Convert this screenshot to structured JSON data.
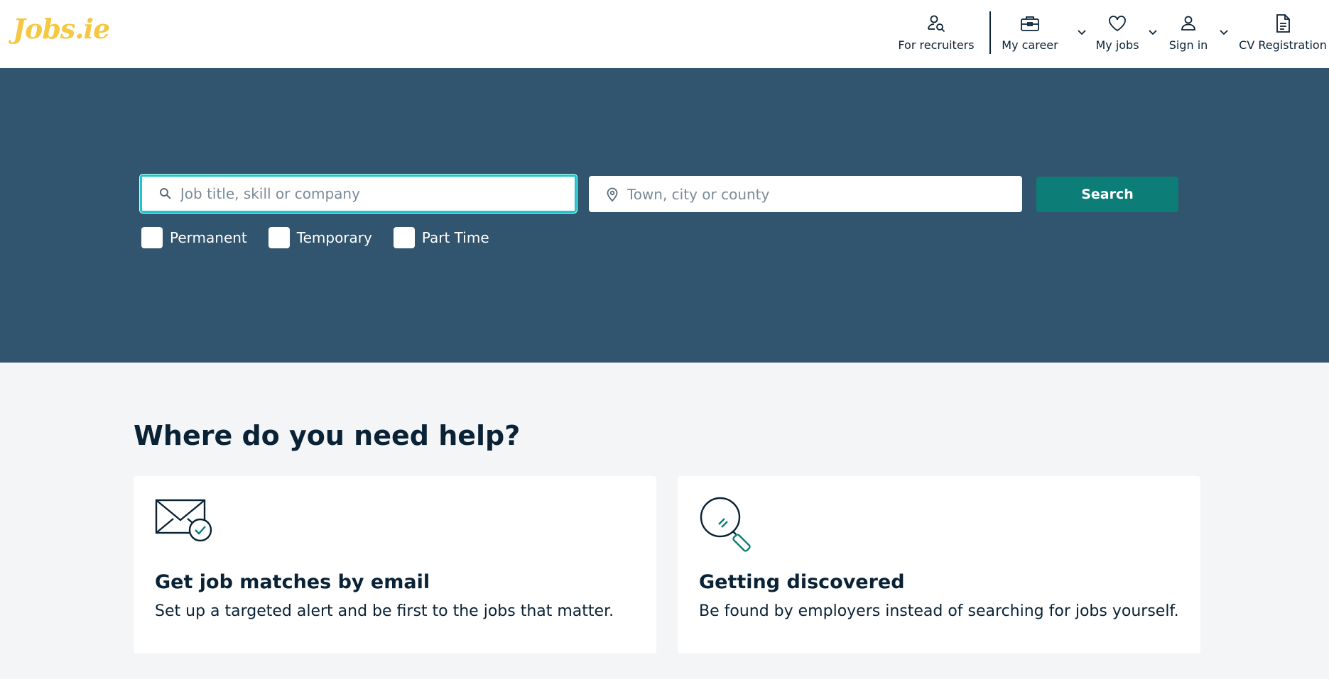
{
  "brand": {
    "logo_text": "Jobs.ie",
    "logo_color": "#f5c842"
  },
  "nav": {
    "for_recruiters": "For recruiters",
    "my_career": "My career",
    "my_jobs": "My jobs",
    "sign_in": "Sign in",
    "cv_registration": "CV Registration"
  },
  "search": {
    "what_placeholder": "Job title, skill or company",
    "where_placeholder": "Town, city or county",
    "button_label": "Search",
    "filters": [
      "Permanent",
      "Temporary",
      "Part Time"
    ]
  },
  "help": {
    "title": "Where do you need help?",
    "cards": [
      {
        "title": "Get job matches by email",
        "description": "Set up a targeted alert and be first to the jobs that matter.",
        "icon": "envelope-check-icon"
      },
      {
        "title": "Getting discovered",
        "description": "Be found by employers instead of searching for jobs yourself.",
        "icon": "magnifier-icon"
      }
    ]
  },
  "colors": {
    "hero_bg": "#32556f",
    "accent": "#0d7d77",
    "focus": "#20c4c9",
    "text": "#0a2235",
    "page_bg": "#f4f5f7"
  }
}
